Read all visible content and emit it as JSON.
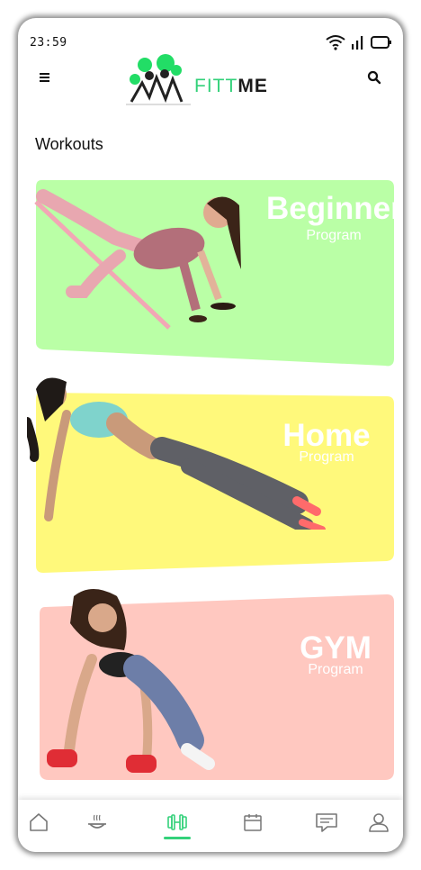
{
  "status_bar": {
    "time": "23:59"
  },
  "header": {
    "logo_text_accent": "FITT",
    "logo_text_main": "ME"
  },
  "section": {
    "title": "Workouts"
  },
  "workouts": [
    {
      "title": "Beginner",
      "subtitle": "Program",
      "color": "#baffa6"
    },
    {
      "title": "Home",
      "subtitle": "Program",
      "color": "#fff97b"
    },
    {
      "title": "GYM",
      "subtitle": "Program",
      "color": "#ffc8c0"
    }
  ],
  "nav": {
    "items": [
      "home-icon",
      "meal-icon",
      "dumbbell-icon",
      "calendar-icon",
      "chat-icon",
      "profile-icon"
    ],
    "active_index": 2,
    "accent": "#33d17a"
  }
}
